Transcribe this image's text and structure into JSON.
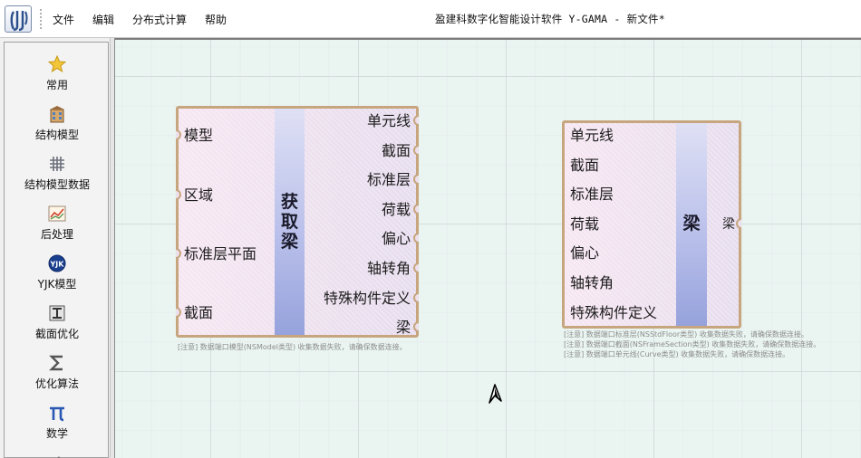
{
  "window": {
    "title": "盈建科数字化智能设计软件 Y-GAMA - 新文件*"
  },
  "menu": {
    "items": [
      {
        "label": "文件"
      },
      {
        "label": "编辑"
      },
      {
        "label": "分布式计算"
      },
      {
        "label": "帮助"
      }
    ]
  },
  "sidebar": {
    "items": [
      {
        "label": "常用",
        "icon": "star-icon"
      },
      {
        "label": "结构模型",
        "icon": "building-icon"
      },
      {
        "label": "结构模型数据",
        "icon": "grid-icon"
      },
      {
        "label": "后处理",
        "icon": "chart-icon"
      },
      {
        "label": "YJK模型",
        "icon": "yjk-logo-icon"
      },
      {
        "label": "截面优化",
        "icon": "section-icon"
      },
      {
        "label": "优化算法",
        "icon": "sigma-icon"
      },
      {
        "label": "数学",
        "icon": "pi-icon"
      }
    ]
  },
  "nodes": {
    "get_beam": {
      "title": "获取梁",
      "inputs": [
        "模型",
        "区域",
        "标准层平面",
        "截面"
      ],
      "outputs": [
        "单元线",
        "截面",
        "标准层",
        "荷载",
        "偏心",
        "轴转角",
        "特殊构件定义",
        "梁"
      ],
      "warning": "[注意] 数据端口模型(NSModel类型) 收集数据失败，请确保数据连接。"
    },
    "beam": {
      "title": "梁",
      "inputs": [
        "单元线",
        "截面",
        "标准层",
        "荷载",
        "偏心",
        "轴转角",
        "特殊构件定义"
      ],
      "outputs": [
        "梁"
      ],
      "warnings": [
        "[注意] 数据端口标准层(NSStdFloor类型) 收集数据失败，请确保数据连接。",
        "[注意] 数据端口截面(NSFrameSection类型) 收集数据失败，请确保数据连接。",
        "[注意] 数据端口单元线(Curve类型) 收集数据失败，请确保数据连接。"
      ]
    }
  },
  "colors": {
    "node_border": "#c7a57e",
    "canvas_bg": "#eaf5f1",
    "node_center": "#96a2dc"
  }
}
